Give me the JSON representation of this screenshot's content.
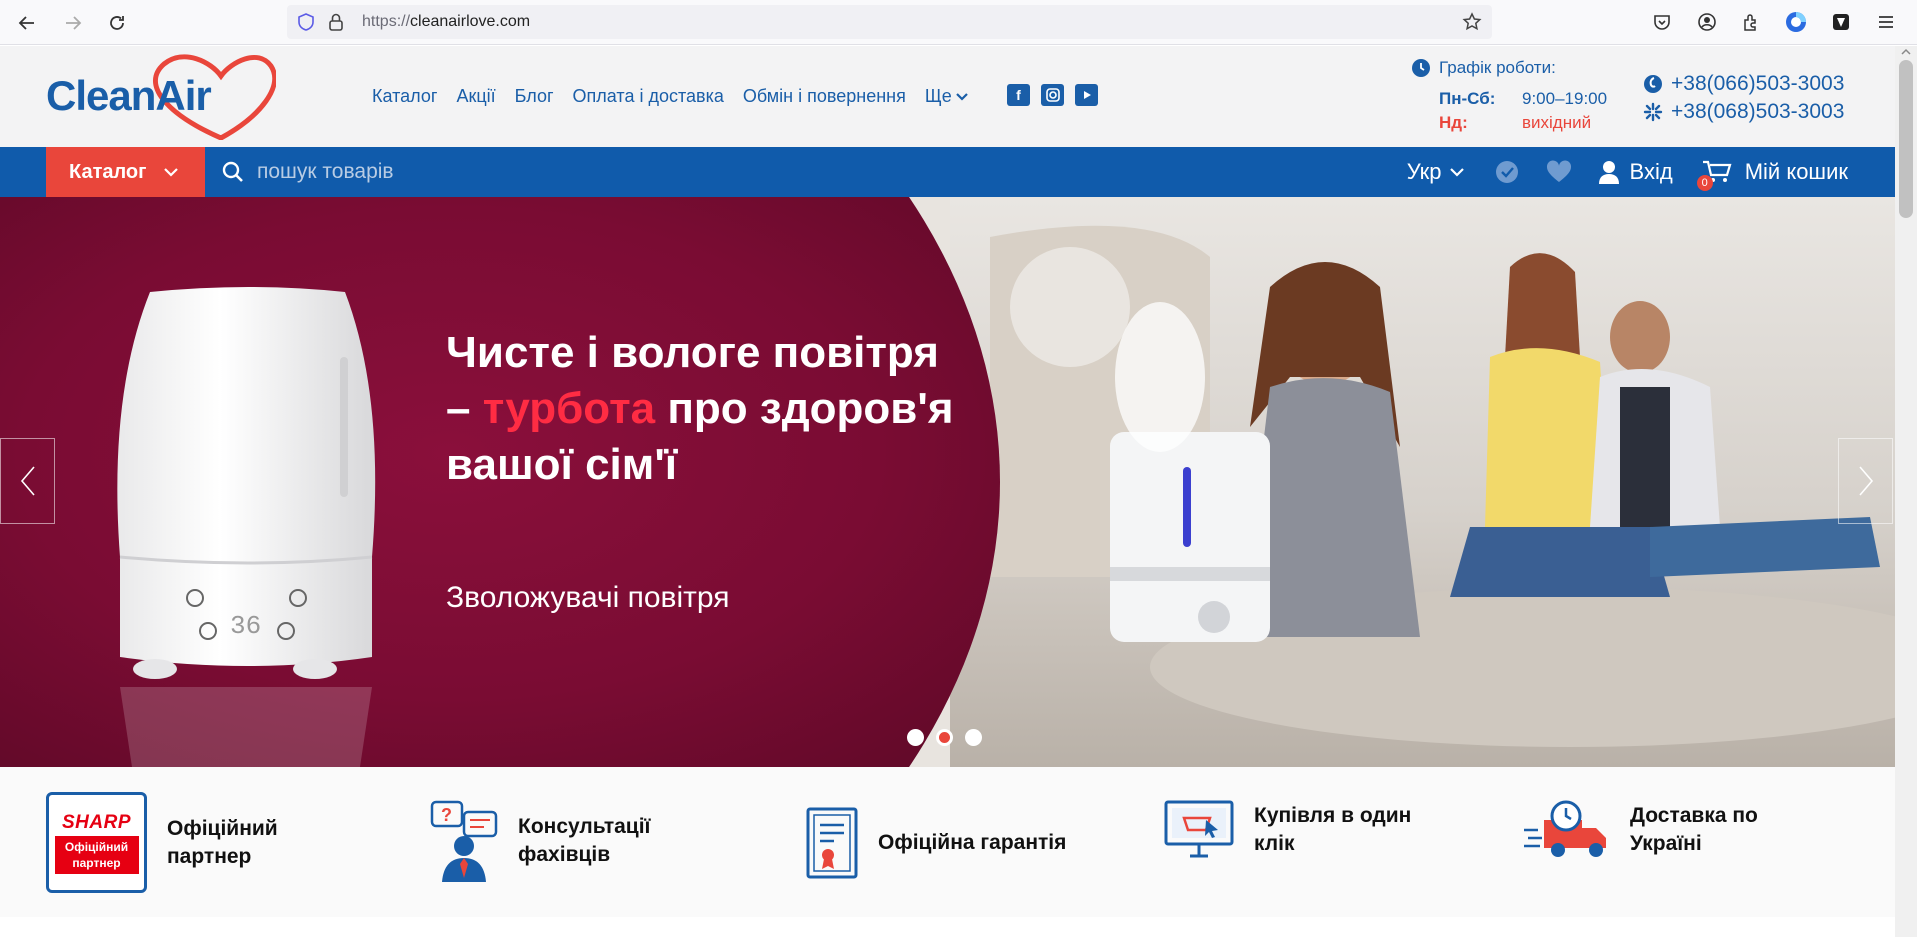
{
  "browser": {
    "url_scheme": "https://",
    "url_host": "cleanairlove.com"
  },
  "header": {
    "logo_text": "CleanAir",
    "menu": [
      "Каталог",
      "Акції",
      "Блог",
      "Оплата і доставка",
      "Обмін і повернення",
      "Ще"
    ],
    "social": [
      "facebook-icon",
      "instagram-icon",
      "youtube-icon"
    ],
    "hours": {
      "title": "Графік роботи:",
      "weekday_label": "Пн-Сб:",
      "weekday_time": "9:00–19:00",
      "sunday_label": "Нд:",
      "sunday_time": "вихідний"
    },
    "phones": [
      "+38(066)503-3003",
      "+38(068)503-3003"
    ]
  },
  "toolbar": {
    "catalog_label": "Каталог",
    "search_placeholder": "пошук товарів",
    "lang_label": "Укр",
    "login_label": "Вхід",
    "cart_label": "Мій кошик",
    "cart_count": "0"
  },
  "hero": {
    "title_part1": "Чисте і вологе повітря – ",
    "title_accent": "турбота",
    "title_part2": " про здоров'я вашої сім'ї",
    "subtitle": "Зволожувачі повітря",
    "slides_total": 3,
    "active_slide": 2,
    "device_display": "36"
  },
  "features": [
    {
      "label": "Офіційний партнер",
      "icon": "sharp-partner-badge",
      "badge_brand": "SHARP",
      "badge_text": "Офіційний партнер"
    },
    {
      "label": "Консультації фахівців",
      "icon": "consultant-icon"
    },
    {
      "label": "Офіційна гарантія",
      "icon": "certificate-icon"
    },
    {
      "label": "Купівля в один клік",
      "icon": "one-click-icon"
    },
    {
      "label": "Доставка по Україні",
      "icon": "delivery-truck-icon"
    }
  ],
  "colors": {
    "brand_blue": "#105bab",
    "accent_red": "#e9463b",
    "hero_bg": "#7a0c33"
  }
}
